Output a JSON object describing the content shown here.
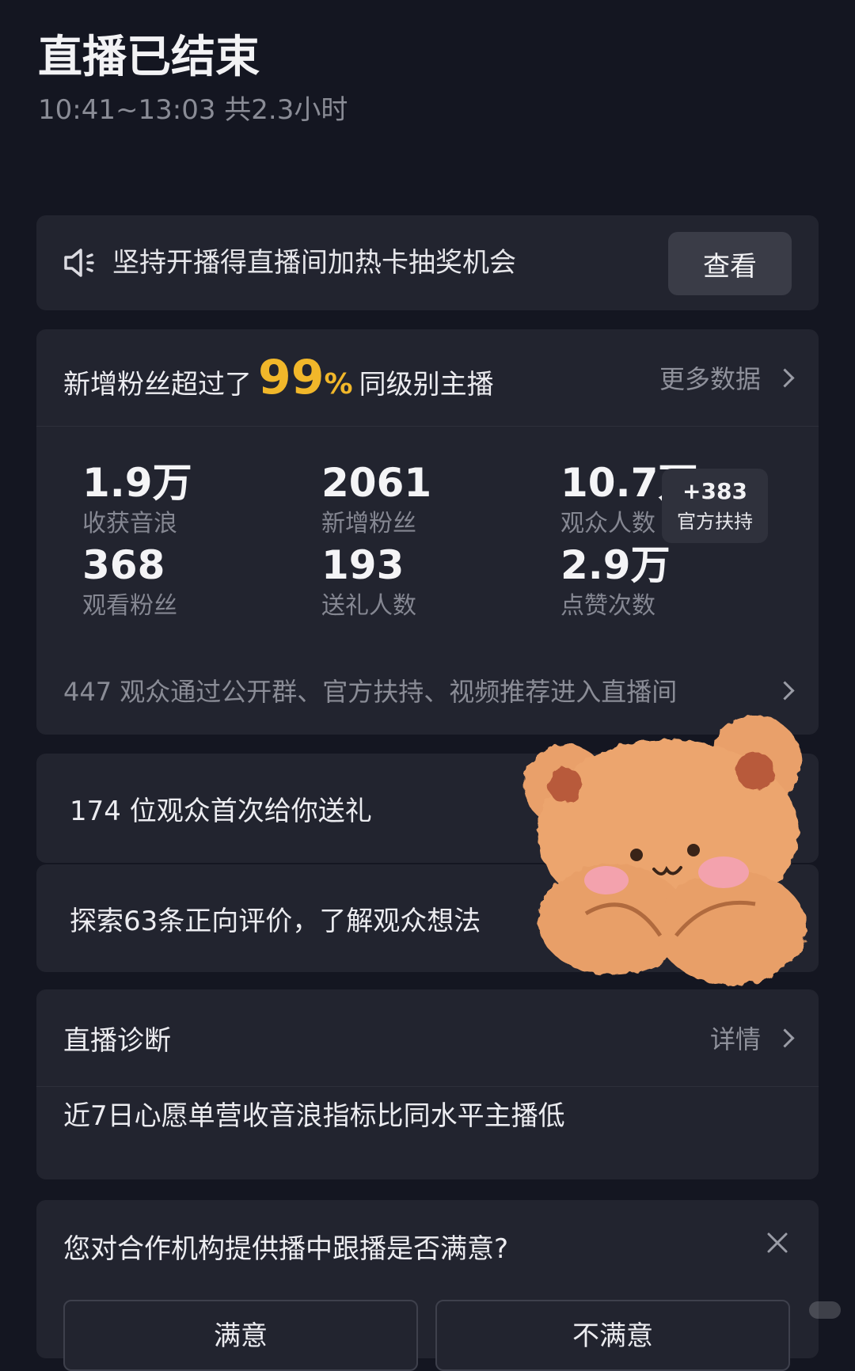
{
  "header": {
    "title": "直播已结束",
    "subtitle": "10:41~13:03 共2.3小时"
  },
  "notice": {
    "icon": "speaker-icon",
    "text": "坚持开播得直播间加热卡抽奖机会",
    "button": "查看"
  },
  "stats": {
    "headline_prefix": "新增粉丝超过了",
    "headline_value": "99",
    "headline_unit": "%",
    "headline_suffix": "同级别主播",
    "headline_color": "#f1b72a",
    "more_link": "更多数据",
    "metrics": [
      {
        "value": "1.9万",
        "label": "收获音浪"
      },
      {
        "value": "2061",
        "label": "新增粉丝"
      },
      {
        "value": "10.7万",
        "label": "观众人数"
      },
      {
        "value": "368",
        "label": "观看粉丝"
      },
      {
        "value": "193",
        "label": "送礼人数"
      },
      {
        "value": "2.9万",
        "label": "点赞次数"
      }
    ],
    "badge": {
      "value": "+383",
      "label": "官方扶持"
    },
    "footer": "447 观众通过公开群、官方扶持、视频推荐进入直播间"
  },
  "gift_row": {
    "text": "174 位观众首次给你送礼"
  },
  "eval_row": {
    "text": "探索63条正向评价，了解观众想法"
  },
  "diagnosis": {
    "title": "直播诊断",
    "more_link": "详情",
    "body": "近7日心愿单营收音浪指标比同水平主播低"
  },
  "survey": {
    "question": "您对合作机构提供播中跟播是否满意?",
    "options": [
      "满意",
      "不满意"
    ],
    "close_icon": "close-icon"
  }
}
